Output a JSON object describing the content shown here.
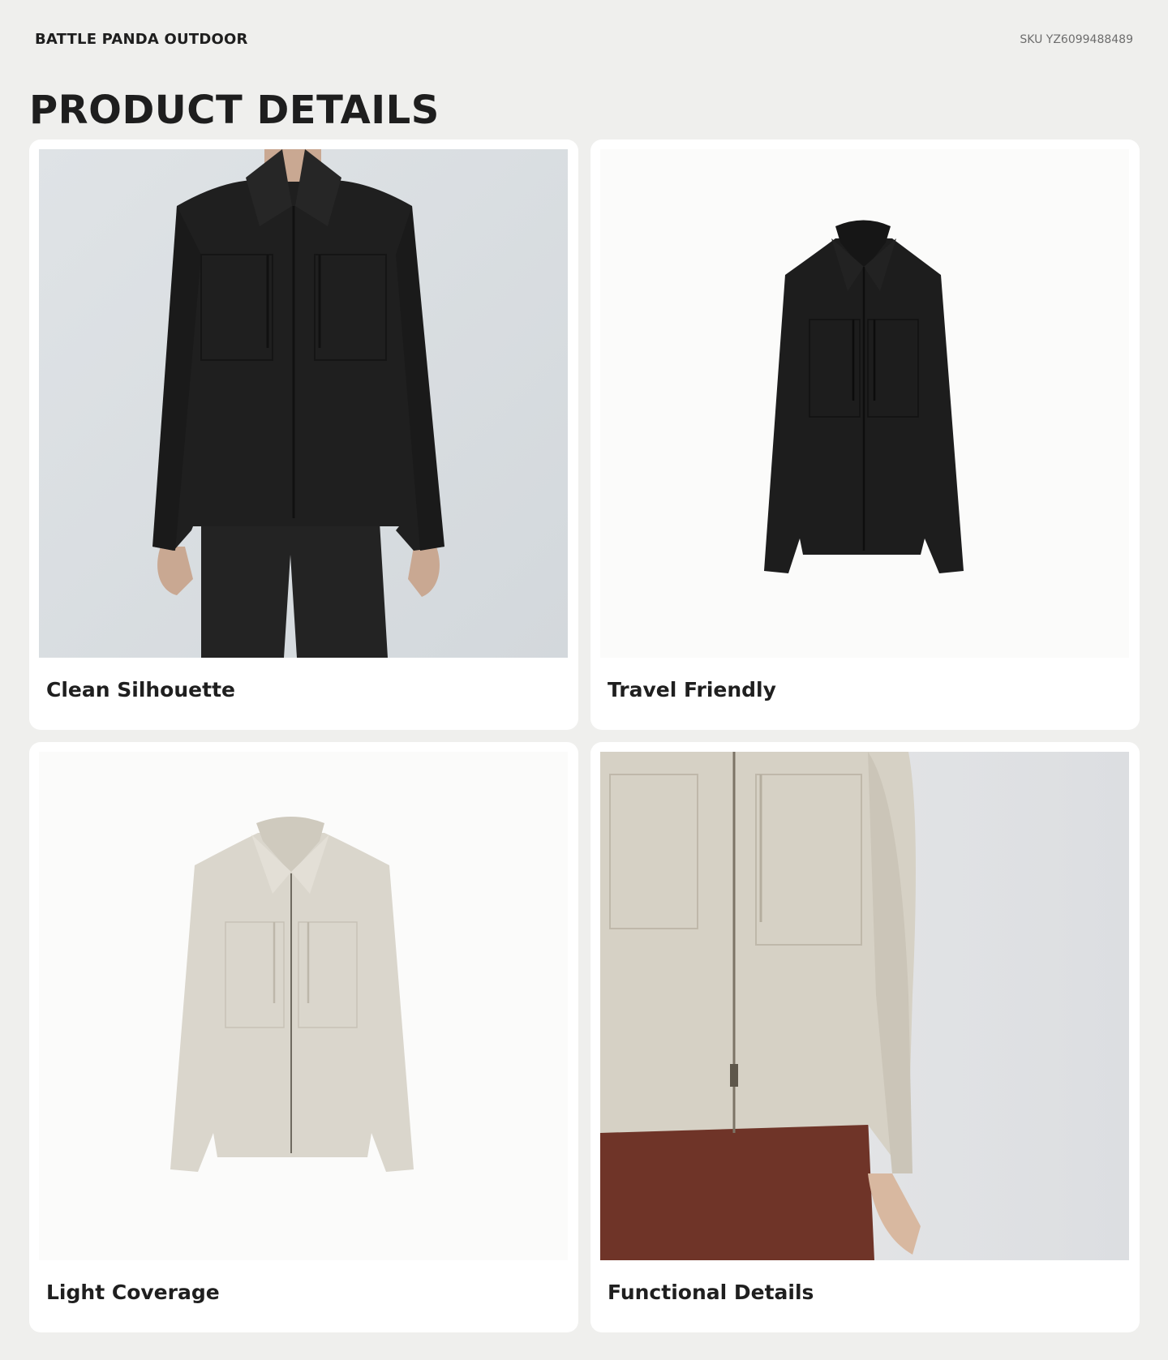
{
  "header": {
    "brand": "BATTLE PANDA OUTDOOR",
    "sku": "SKU YZ6099488489"
  },
  "page_title": "PRODUCT DETAILS",
  "cards": [
    {
      "caption": "Clean Silhouette",
      "image": "model-wearing-black-zip-jacket",
      "jacket_color": "#1f1f1f"
    },
    {
      "caption": "Travel Friendly",
      "image": "black-zip-jacket-flat",
      "jacket_color": "#1d1d1d"
    },
    {
      "caption": "Light Coverage",
      "image": "stone-zip-jacket-flat",
      "jacket_color": "#dad6cc"
    },
    {
      "caption": "Functional Details",
      "image": "stone-zip-jacket-closeup",
      "jacket_color": "#d6d1c5"
    }
  ],
  "colors": {
    "page_background": "#efefed",
    "card_background": "#ffffff"
  }
}
